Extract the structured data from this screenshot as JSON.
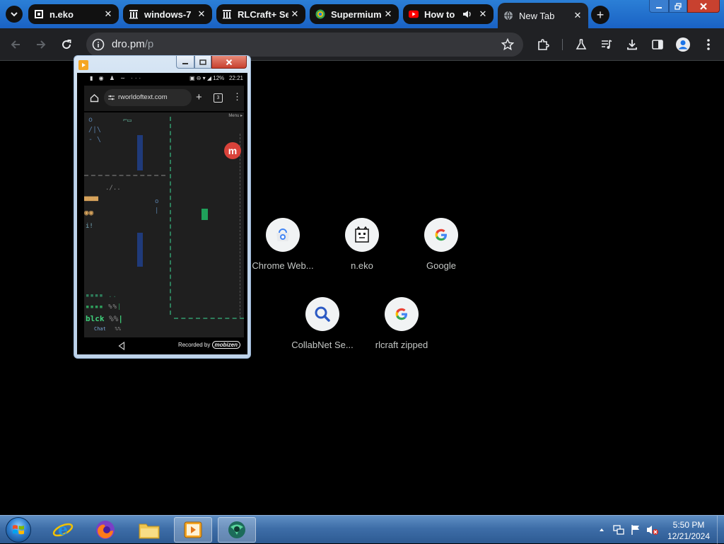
{
  "browser": {
    "tabs": [
      {
        "title": "n.eko",
        "icon": "neko-favicon-icon"
      },
      {
        "title": "windows-7",
        "icon": "archive-icon"
      },
      {
        "title": "RLCraft+ Se",
        "icon": "archive-icon"
      },
      {
        "title": "Supermium",
        "icon": "supermium-icon"
      },
      {
        "title": "How to",
        "icon": "youtube-icon",
        "audio": true
      },
      {
        "title": "New Tab",
        "icon": "globe-icon",
        "active": true
      }
    ],
    "address": {
      "host": "dro.pm",
      "path": "/p"
    },
    "colors": {
      "tabstrip": "#1a62c4",
      "toolbar": "#202124",
      "page_bg": "#000000"
    }
  },
  "shortcuts": [
    {
      "label": "Chrome Web...",
      "icon": "chrome-web-store-icon"
    },
    {
      "label": "n.eko",
      "icon": "neko-icon"
    },
    {
      "label": "Google",
      "icon": "google-g-icon"
    },
    {
      "label": "CollabNet Se...",
      "icon": "magnifier-icon"
    },
    {
      "label": "rlcraft zipped",
      "icon": "google-g-icon"
    }
  ],
  "mobizen": {
    "status": {
      "battery": "12%",
      "time": "22:21"
    },
    "url": "rworldoftext.com",
    "tabs_count": "3",
    "menu": "Menu ▸",
    "canvas_text": {
      "blck": "blck",
      "chat": "Chat",
      "percent": "%%"
    },
    "recorded_by": "Recorded by",
    "brand": "mobizen"
  },
  "taskbar": {
    "apps": [
      "start-orb",
      "internet-explorer-icon",
      "firefox-icon",
      "file-explorer-icon",
      "mobizen-icon",
      "supermium-icon"
    ],
    "clock": {
      "time": "5:50 PM",
      "date": "12/21/2024"
    }
  }
}
